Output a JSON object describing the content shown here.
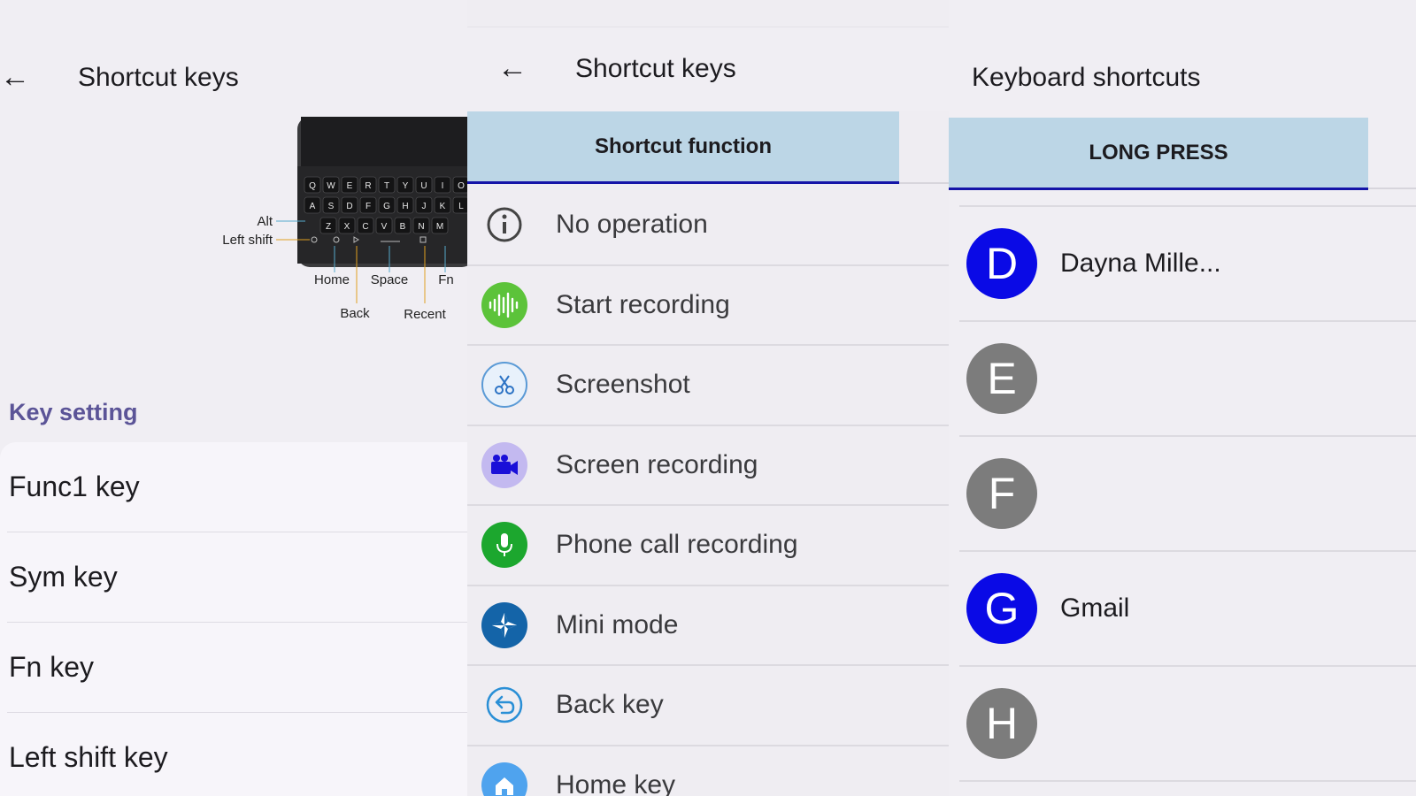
{
  "left_panel": {
    "title": "Shortcut keys",
    "keyboard_labels": {
      "alt": "Alt",
      "left_shift": "Left shift",
      "home": "Home",
      "space": "Space",
      "fn": "Fn",
      "back": "Back",
      "recent": "Recent"
    },
    "keyboard_rows": [
      [
        "Q",
        "W",
        "E",
        "R",
        "T",
        "Y",
        "U",
        "I",
        "O"
      ],
      [
        "A",
        "S",
        "D",
        "F",
        "G",
        "H",
        "J",
        "K",
        "L"
      ],
      [
        "Z",
        "X",
        "C",
        "V",
        "B",
        "N",
        "M"
      ]
    ],
    "section_header": "Key setting",
    "key_items": [
      "Func1 key",
      "Sym key",
      "Fn key",
      "Left shift key"
    ]
  },
  "middle_panel": {
    "title": "Shortcut keys",
    "tab_label": "Shortcut function",
    "functions": [
      {
        "label": "No operation",
        "icon": "info-icon"
      },
      {
        "label": "Start recording",
        "icon": "waveform-icon"
      },
      {
        "label": "Screenshot",
        "icon": "scissors-icon"
      },
      {
        "label": "Screen recording",
        "icon": "video-camera-icon"
      },
      {
        "label": "Phone call recording",
        "icon": "microphone-icon"
      },
      {
        "label": "Mini mode",
        "icon": "mini-mode-icon"
      },
      {
        "label": "Back key",
        "icon": "back-key-icon"
      },
      {
        "label": "Home key",
        "icon": "home-icon"
      }
    ]
  },
  "right_panel": {
    "title": "Keyboard shortcuts",
    "tab_label": "LONG PRESS",
    "contacts": [
      {
        "letter": "D",
        "name": "Dayna Mille...",
        "color": "#0a0ae6"
      },
      {
        "letter": "E",
        "name": "",
        "color": "#7c7c7c"
      },
      {
        "letter": "F",
        "name": "",
        "color": "#7c7c7c"
      },
      {
        "letter": "G",
        "name": "Gmail",
        "color": "#0a0ae6"
      },
      {
        "letter": "H",
        "name": "",
        "color": "#7c7c7c"
      }
    ]
  },
  "colors": {
    "accent_blue": "#1515a8",
    "tab_bg": "#bcd6e6",
    "section_header": "#5b5497"
  }
}
